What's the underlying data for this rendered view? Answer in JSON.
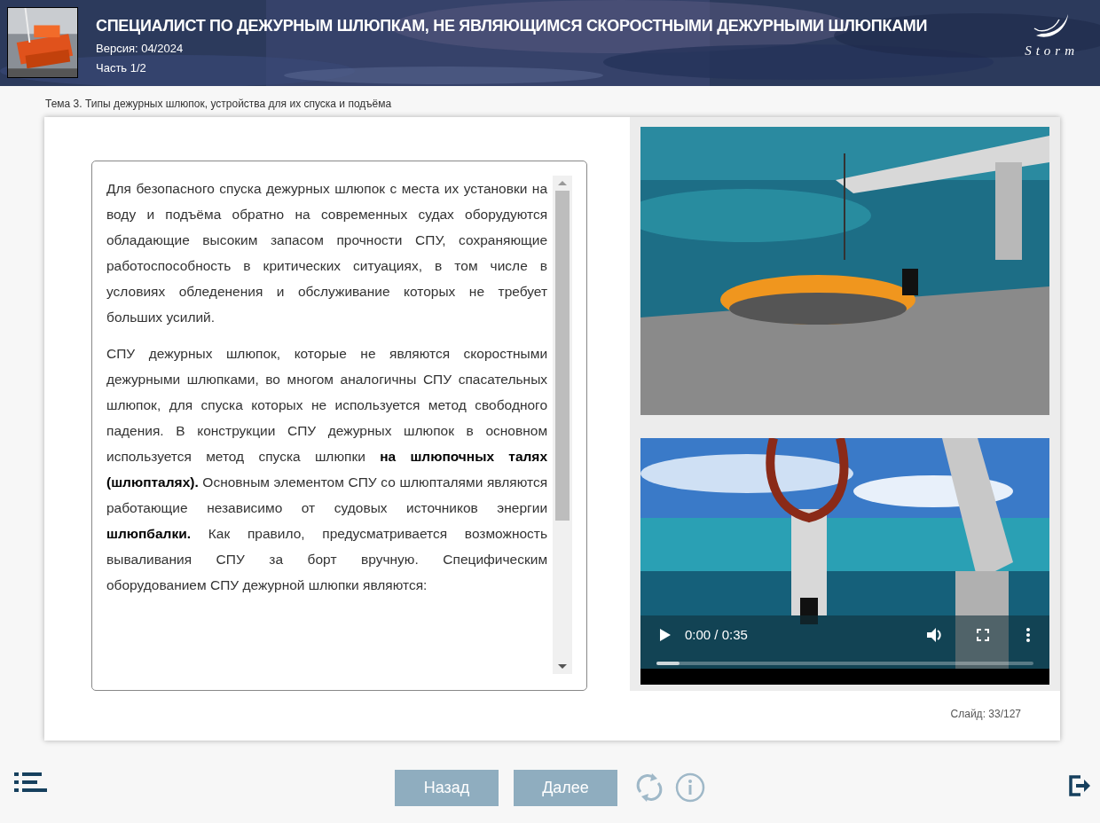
{
  "header": {
    "title": "СПЕЦИАЛИСТ ПО ДЕЖУРНЫМ ШЛЮПКАМ, НЕ ЯВЛЯЮЩИМСЯ СКОРОСТНЫМИ ДЕЖУРНЫМИ ШЛЮПКАМИ",
    "version": "Версия: 04/2024",
    "part": "Часть 1/2",
    "logo": "Storm"
  },
  "breadcrumb": "Тема 3. Типы дежурных шлюпок, устройства для их спуска и подъёма",
  "content": {
    "paragraphs": [
      "Для безопасного спуска дежурных шлюпок с места их установки на воду и подъёма обратно на современных судах оборудуются обладающие высоким запасом прочности СПУ, сохраняющие работоспособность в критических ситуациях, в том числе в условиях обледенения и обслуживание которых не требует больших усилий.",
      "СПУ дежурных шлюпок, которые не являются скоростными дежурными шлюпками, во многом аналогичны СПУ спасательных шлюпок, для спуска которых не используется метод свободного падения. В конструкции СПУ дежурных шлюпок в основном используется метод спуска шлюпки **на шлюпочных талях (шлюпталях).** Основным элементом СПУ со шлюпталями являются работающие независимо от судовых источников энергии **шлюпбалки.** Как правило, предусматривается возможность вываливания СПУ за борт вручную. Специфическим оборудованием СПУ дежурной шлюпки являются:"
    ]
  },
  "media": [
    {
      "kind": "picture"
    },
    {
      "kind": "video",
      "time": "0:00 / 0:35",
      "progress": {
        "level": 0.06
      }
    }
  ],
  "slide_counter": "Слайд: 33/127",
  "footer": {
    "buttons": [
      "Назад",
      "Далее"
    ]
  }
}
